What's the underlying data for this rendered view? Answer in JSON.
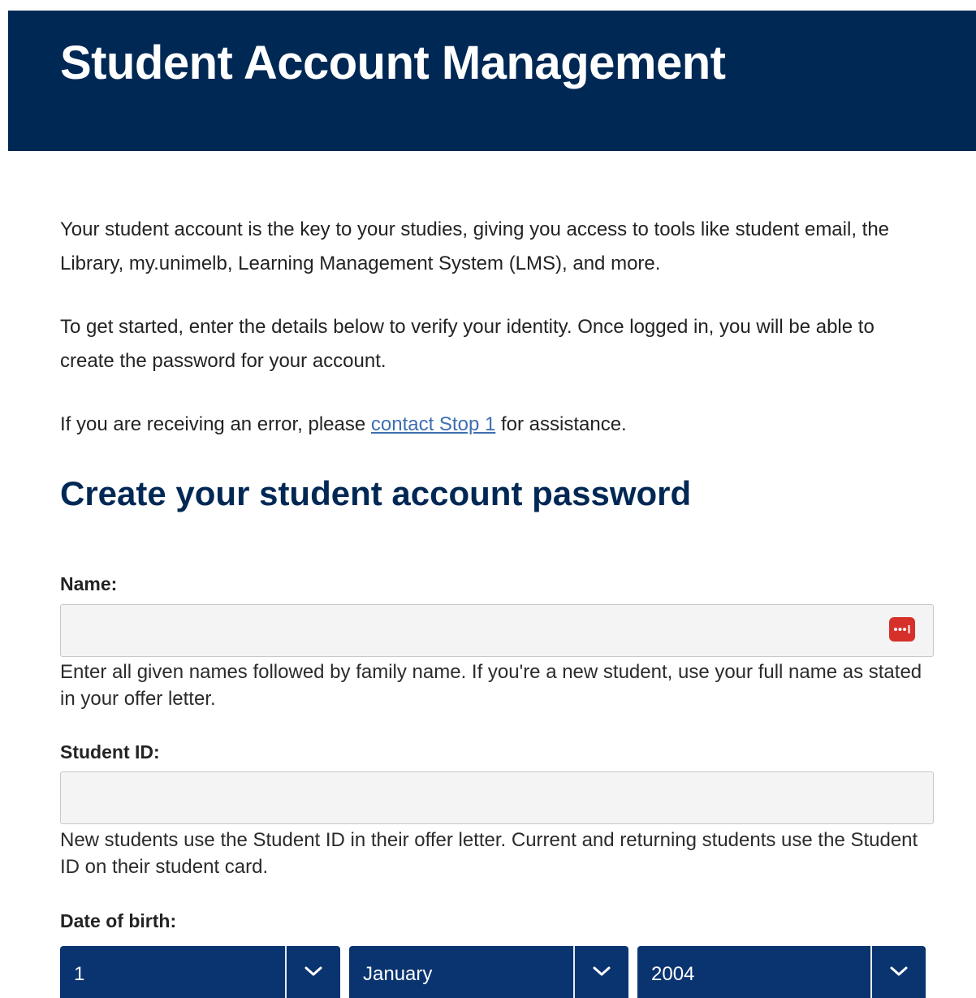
{
  "header": {
    "title": "Student Account Management"
  },
  "intro": {
    "paragraph_1": "Your student account is the key to your studies, giving you access to tools like student email, the Library, my.unimelb, Learning Management System (LMS), and more.",
    "paragraph_2": "To get started, enter the details below to verify your identity. Once logged in, you will be able to create the password for your account.",
    "paragraph_3_before": "If you are receiving an error, please ",
    "paragraph_3_link": "contact Stop 1",
    "paragraph_3_after": " for assistance."
  },
  "form": {
    "title": "Create your student account password",
    "name": {
      "label": "Name:",
      "value": "",
      "help": "Enter all given names followed by family name. If you're a new student, use your full name as stated in your offer letter.",
      "icon": "password-manager-icon"
    },
    "student_id": {
      "label": "Student ID:",
      "value": "",
      "help": "New students use the Student ID in their offer letter. Current and returning students use the Student ID on their student card."
    },
    "dob": {
      "label": "Date of birth:",
      "day": "1",
      "month": "January",
      "year": "2004",
      "icon": "chevron-down-icon"
    }
  },
  "colors": {
    "header_bg": "#002855",
    "title_color": "#002855",
    "select_bg": "#0a3470",
    "link": "#3d6fb1",
    "password_icon_bg": "#d6302b"
  }
}
